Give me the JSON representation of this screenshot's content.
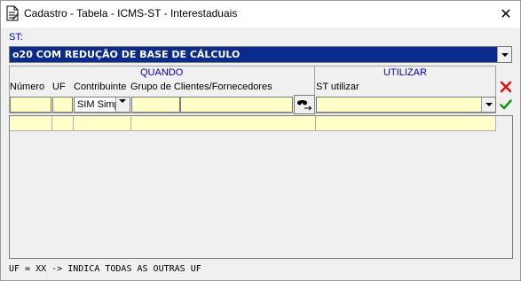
{
  "window": {
    "title": "Cadastro - Tabela - ICMS-ST - Interestaduais",
    "close_label": "✕"
  },
  "st": {
    "label": "ST:",
    "selected": "o20 COM REDUÇÃO DE BASE DE CÁLCULO"
  },
  "groups": {
    "quando": "QUANDO",
    "utilizar": "UTILIZAR"
  },
  "columns": {
    "numero": "Número",
    "uf": "UF",
    "contribuinte": "Contribuinte",
    "grupo": "Grupo de Clientes/Fornecedores",
    "st_utilizar": "ST utilizar"
  },
  "inputs": {
    "numero": "",
    "uf": "",
    "contribuinte": "SIM Simp",
    "grupo_codigo": "",
    "grupo_nome": "",
    "st_utilizar": ""
  },
  "icons": {
    "window": "document-edit-icon",
    "search": "binoculars-icon",
    "delete": "red-x-icon",
    "confirm": "green-check-icon"
  },
  "colors": {
    "field_bg": "#ffffc8",
    "label_blue": "#0000c0",
    "selection_bg": "#0a2a8c"
  },
  "footer": {
    "note": "UF = XX -> INDICA TODAS AS OUTRAS UF"
  }
}
